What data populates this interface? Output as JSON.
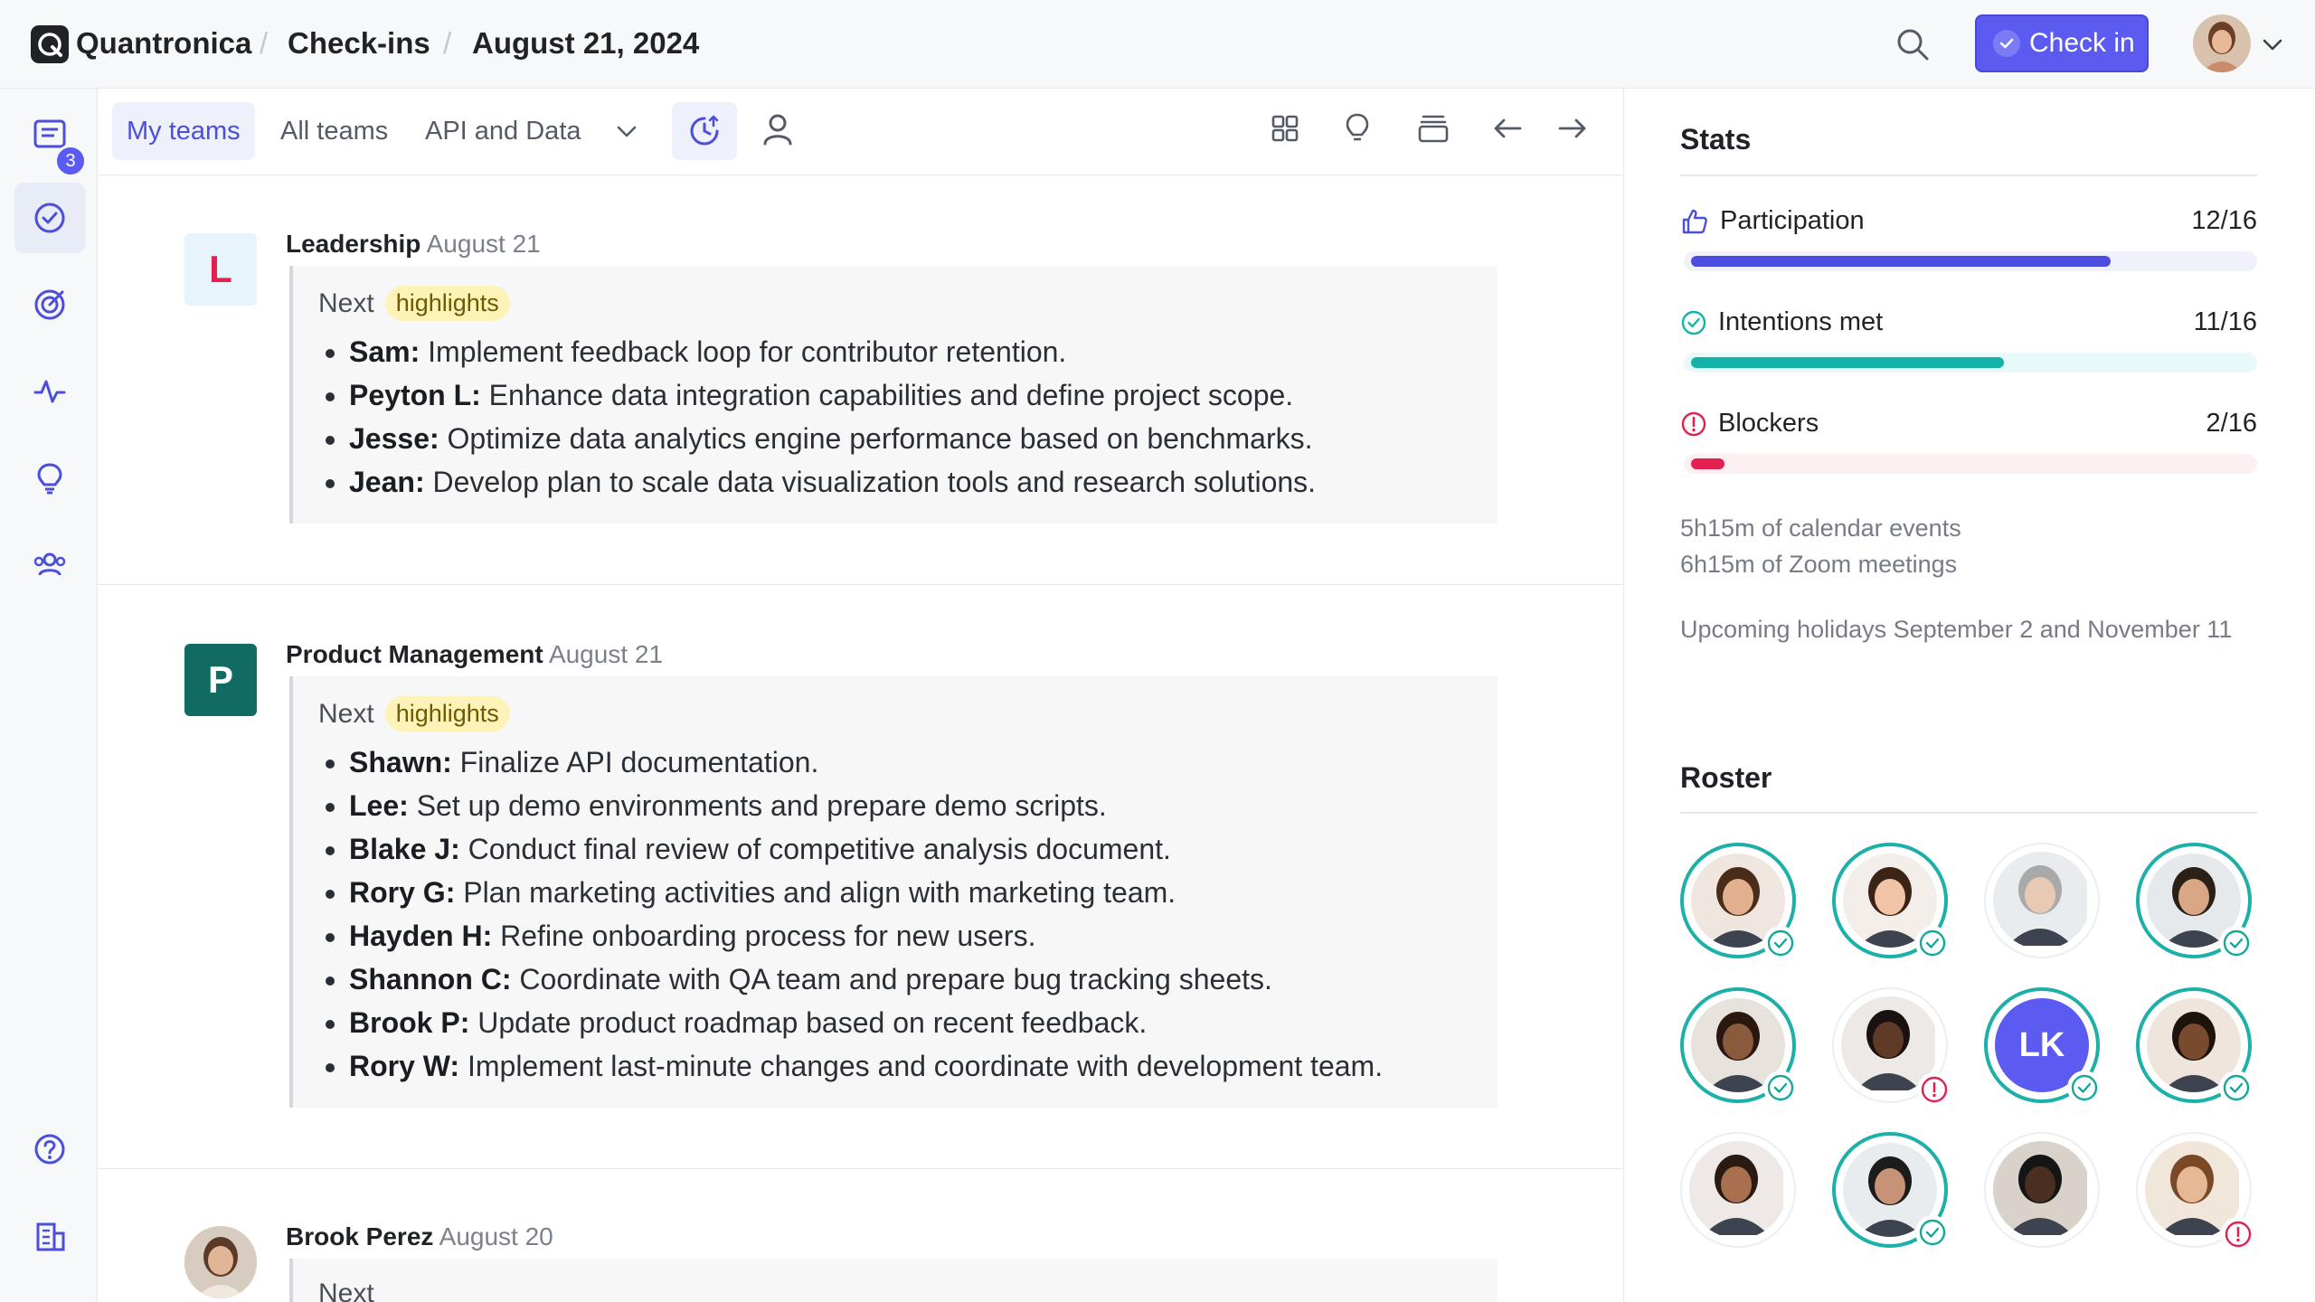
{
  "header": {
    "app_name": "Quantronica",
    "breadcrumb_section": "Check-ins",
    "breadcrumb_date": "August 21, 2024",
    "check_in_label": "Check in"
  },
  "sidebar": {
    "items": [
      {
        "name": "checkins-feed",
        "icon": "list-icon",
        "badge": "3"
      },
      {
        "name": "checkins",
        "icon": "check-circle-icon",
        "active": true
      },
      {
        "name": "goals",
        "icon": "target-icon"
      },
      {
        "name": "pulse",
        "icon": "activity-icon"
      },
      {
        "name": "ideas",
        "icon": "lightbulb-icon"
      },
      {
        "name": "people",
        "icon": "people-icon"
      },
      {
        "name": "help",
        "icon": "help-icon"
      },
      {
        "name": "company",
        "icon": "building-icon"
      }
    ]
  },
  "toolbar": {
    "tabs": [
      "My teams",
      "All teams",
      "API and Data"
    ],
    "active_tab": "My teams"
  },
  "feed": {
    "entries": [
      {
        "avatar_letter": "L",
        "team": "Leadership",
        "date": "August 21",
        "next_label": "Next",
        "highlight_label": "highlights",
        "items": [
          {
            "who": "Sam:",
            "text": " Implement feedback loop for contributor retention."
          },
          {
            "who": "Peyton L:",
            "text": " Enhance data integration capabilities and define project scope."
          },
          {
            "who": "Jesse:",
            "text": " Optimize data analytics engine performance based on benchmarks."
          },
          {
            "who": "Jean:",
            "text": " Develop plan to scale data visualization tools and research solutions."
          }
        ]
      },
      {
        "avatar_letter": "P",
        "team": "Product Management",
        "date": "August 21",
        "next_label": "Next",
        "highlight_label": "highlights",
        "items": [
          {
            "who": "Shawn:",
            "text": " Finalize API documentation."
          },
          {
            "who": "Lee:",
            "text": " Set up demo environments and prepare demo scripts."
          },
          {
            "who": "Blake J:",
            "text": " Conduct final review of competitive analysis document."
          },
          {
            "who": "Rory G:",
            "text": " Plan marketing activities and align with marketing team."
          },
          {
            "who": "Hayden H:",
            "text": " Refine onboarding process for new users."
          },
          {
            "who": "Shannon C:",
            "text": " Coordinate with QA team and prepare bug tracking sheets."
          },
          {
            "who": "Brook P:",
            "text": " Update product roadmap based on recent feedback."
          },
          {
            "who": "Rory W:",
            "text": " Implement last-minute changes and coordinate with development team."
          }
        ]
      },
      {
        "person": "Brook Perez",
        "date": "August 20",
        "next_label": "Next"
      }
    ]
  },
  "stats": {
    "title": "Stats",
    "participation": {
      "label": "Participation",
      "value": "12/16",
      "fraction": 0.75,
      "color": "#4c4ce0",
      "track": "#f0f1fb"
    },
    "intentions": {
      "label": "Intentions met",
      "value": "11/16",
      "fraction": 0.56,
      "color": "#14b3aa",
      "track": "#e7f9f8"
    },
    "blockers": {
      "label": "Blockers",
      "value": "2/16",
      "fraction": 0.06,
      "color": "#e3204f",
      "track": "#fdf0f3"
    },
    "calendar_text": "5h15m of calendar events",
    "zoom_text": "6h15m of Zoom meetings",
    "holidays_text": "Upcoming holidays September 2 and November 11"
  },
  "roster": {
    "title": "Roster",
    "members": [
      {
        "status": "check",
        "ring": true
      },
      {
        "status": "check",
        "ring": true
      },
      {
        "status": "none",
        "ring": false
      },
      {
        "status": "check",
        "ring": true
      },
      {
        "status": "check",
        "ring": true
      },
      {
        "status": "alert",
        "ring": false
      },
      {
        "initials": "LK",
        "status": "check",
        "ring": true
      },
      {
        "status": "check",
        "ring": true
      },
      {
        "status": "none",
        "ring": false
      },
      {
        "status": "check",
        "ring": true
      },
      {
        "status": "none",
        "ring": false
      },
      {
        "status": "alert",
        "ring": false
      }
    ]
  },
  "colors": {
    "accent": "#5b5bf2",
    "teal": "#1cb0a8",
    "alert": "#e3204f",
    "leadership_avatar_bg": "#e8f4fb",
    "leadership_avatar_fg": "#e3204f",
    "product_avatar_bg": "#116b63"
  }
}
